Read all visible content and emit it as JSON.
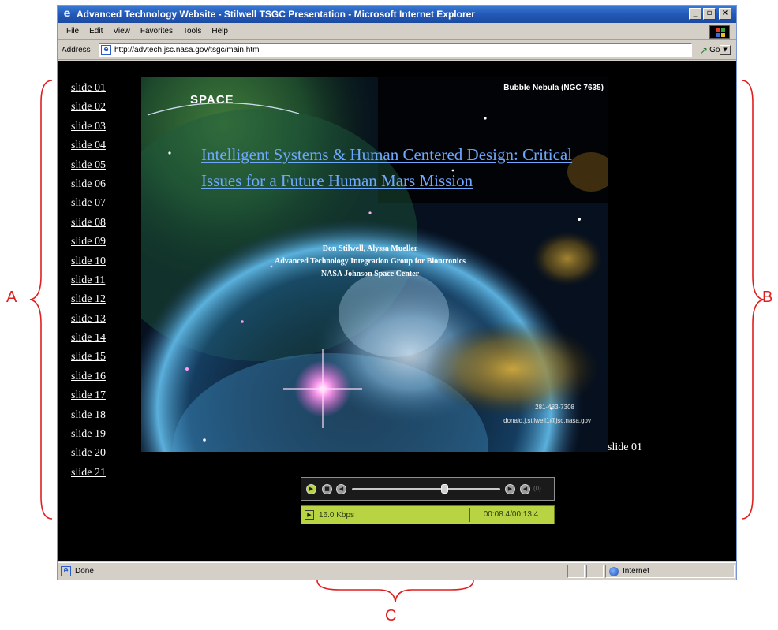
{
  "window": {
    "title": "Advanced Technology Website - Stilwell TSGC Presentation - Microsoft Internet Explorer",
    "min_glyph": "_",
    "max_glyph": "▫",
    "close_glyph": "×"
  },
  "menu": [
    "File",
    "Edit",
    "View",
    "Favorites",
    "Tools",
    "Help"
  ],
  "address": {
    "label": "Address",
    "url": "http://advtech.jsc.nasa.gov/tsgc/main.htm",
    "go_label": "Go"
  },
  "slide_nav": [
    "slide 01",
    "slide 02",
    "slide 03",
    "slide 04",
    "slide 05",
    "slide 06",
    "slide 07",
    "slide 08",
    "slide 09",
    "slide 10",
    "slide 11",
    "slide 12",
    "slide 13",
    "slide 14",
    "slide 15",
    "slide 16",
    "slide 17",
    "slide 18",
    "slide 19",
    "slide 20",
    "slide 21"
  ],
  "slide": {
    "nebula_label": "Bubble Nebula (NGC 7635)",
    "logo_text": "SPACE",
    "title": "Intelligent Systems & Human Centered Design:  Critical Issues for a Future Human Mars Mission",
    "authors": "Don Stilwell, Alyssa Mueller",
    "group": "Advanced Technology Integration Group for Biontronics",
    "center": "NASA Johnson Space Center",
    "phone": "281-483-7308",
    "email": "donald.j.stilwell1@jsc.nasa.gov",
    "current_label": "slide 01"
  },
  "player": {
    "progress": 0.62,
    "volume_label": "(0)",
    "bitrate": "16.0 Kbps",
    "time": "00:08.4/00:13.4",
    "accent_color": "#b8d442"
  },
  "statusbar": {
    "status": "Done",
    "zone": "Internet"
  },
  "annotations": {
    "a": "A",
    "b": "B",
    "c": "C"
  }
}
